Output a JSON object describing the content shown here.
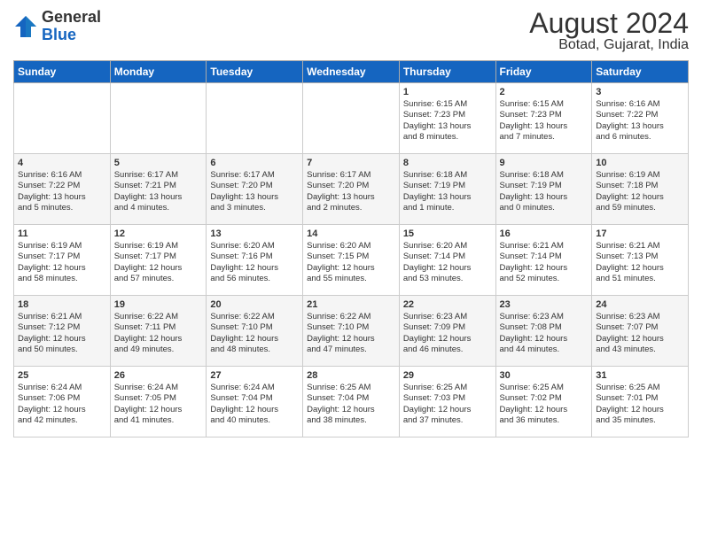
{
  "header": {
    "logo_general": "General",
    "logo_blue": "Blue",
    "month_year": "August 2024",
    "location": "Botad, Gujarat, India"
  },
  "days_of_week": [
    "Sunday",
    "Monday",
    "Tuesday",
    "Wednesday",
    "Thursday",
    "Friday",
    "Saturday"
  ],
  "weeks": [
    [
      {
        "day": "",
        "content": ""
      },
      {
        "day": "",
        "content": ""
      },
      {
        "day": "",
        "content": ""
      },
      {
        "day": "",
        "content": ""
      },
      {
        "day": "1",
        "content": "Sunrise: 6:15 AM\nSunset: 7:23 PM\nDaylight: 13 hours\nand 8 minutes."
      },
      {
        "day": "2",
        "content": "Sunrise: 6:15 AM\nSunset: 7:23 PM\nDaylight: 13 hours\nand 7 minutes."
      },
      {
        "day": "3",
        "content": "Sunrise: 6:16 AM\nSunset: 7:22 PM\nDaylight: 13 hours\nand 6 minutes."
      }
    ],
    [
      {
        "day": "4",
        "content": "Sunrise: 6:16 AM\nSunset: 7:22 PM\nDaylight: 13 hours\nand 5 minutes."
      },
      {
        "day": "5",
        "content": "Sunrise: 6:17 AM\nSunset: 7:21 PM\nDaylight: 13 hours\nand 4 minutes."
      },
      {
        "day": "6",
        "content": "Sunrise: 6:17 AM\nSunset: 7:20 PM\nDaylight: 13 hours\nand 3 minutes."
      },
      {
        "day": "7",
        "content": "Sunrise: 6:17 AM\nSunset: 7:20 PM\nDaylight: 13 hours\nand 2 minutes."
      },
      {
        "day": "8",
        "content": "Sunrise: 6:18 AM\nSunset: 7:19 PM\nDaylight: 13 hours\nand 1 minute."
      },
      {
        "day": "9",
        "content": "Sunrise: 6:18 AM\nSunset: 7:19 PM\nDaylight: 13 hours\nand 0 minutes."
      },
      {
        "day": "10",
        "content": "Sunrise: 6:19 AM\nSunset: 7:18 PM\nDaylight: 12 hours\nand 59 minutes."
      }
    ],
    [
      {
        "day": "11",
        "content": "Sunrise: 6:19 AM\nSunset: 7:17 PM\nDaylight: 12 hours\nand 58 minutes."
      },
      {
        "day": "12",
        "content": "Sunrise: 6:19 AM\nSunset: 7:17 PM\nDaylight: 12 hours\nand 57 minutes."
      },
      {
        "day": "13",
        "content": "Sunrise: 6:20 AM\nSunset: 7:16 PM\nDaylight: 12 hours\nand 56 minutes."
      },
      {
        "day": "14",
        "content": "Sunrise: 6:20 AM\nSunset: 7:15 PM\nDaylight: 12 hours\nand 55 minutes."
      },
      {
        "day": "15",
        "content": "Sunrise: 6:20 AM\nSunset: 7:14 PM\nDaylight: 12 hours\nand 53 minutes."
      },
      {
        "day": "16",
        "content": "Sunrise: 6:21 AM\nSunset: 7:14 PM\nDaylight: 12 hours\nand 52 minutes."
      },
      {
        "day": "17",
        "content": "Sunrise: 6:21 AM\nSunset: 7:13 PM\nDaylight: 12 hours\nand 51 minutes."
      }
    ],
    [
      {
        "day": "18",
        "content": "Sunrise: 6:21 AM\nSunset: 7:12 PM\nDaylight: 12 hours\nand 50 minutes."
      },
      {
        "day": "19",
        "content": "Sunrise: 6:22 AM\nSunset: 7:11 PM\nDaylight: 12 hours\nand 49 minutes."
      },
      {
        "day": "20",
        "content": "Sunrise: 6:22 AM\nSunset: 7:10 PM\nDaylight: 12 hours\nand 48 minutes."
      },
      {
        "day": "21",
        "content": "Sunrise: 6:22 AM\nSunset: 7:10 PM\nDaylight: 12 hours\nand 47 minutes."
      },
      {
        "day": "22",
        "content": "Sunrise: 6:23 AM\nSunset: 7:09 PM\nDaylight: 12 hours\nand 46 minutes."
      },
      {
        "day": "23",
        "content": "Sunrise: 6:23 AM\nSunset: 7:08 PM\nDaylight: 12 hours\nand 44 minutes."
      },
      {
        "day": "24",
        "content": "Sunrise: 6:23 AM\nSunset: 7:07 PM\nDaylight: 12 hours\nand 43 minutes."
      }
    ],
    [
      {
        "day": "25",
        "content": "Sunrise: 6:24 AM\nSunset: 7:06 PM\nDaylight: 12 hours\nand 42 minutes."
      },
      {
        "day": "26",
        "content": "Sunrise: 6:24 AM\nSunset: 7:05 PM\nDaylight: 12 hours\nand 41 minutes."
      },
      {
        "day": "27",
        "content": "Sunrise: 6:24 AM\nSunset: 7:04 PM\nDaylight: 12 hours\nand 40 minutes."
      },
      {
        "day": "28",
        "content": "Sunrise: 6:25 AM\nSunset: 7:04 PM\nDaylight: 12 hours\nand 38 minutes."
      },
      {
        "day": "29",
        "content": "Sunrise: 6:25 AM\nSunset: 7:03 PM\nDaylight: 12 hours\nand 37 minutes."
      },
      {
        "day": "30",
        "content": "Sunrise: 6:25 AM\nSunset: 7:02 PM\nDaylight: 12 hours\nand 36 minutes."
      },
      {
        "day": "31",
        "content": "Sunrise: 6:25 AM\nSunset: 7:01 PM\nDaylight: 12 hours\nand 35 minutes."
      }
    ]
  ]
}
